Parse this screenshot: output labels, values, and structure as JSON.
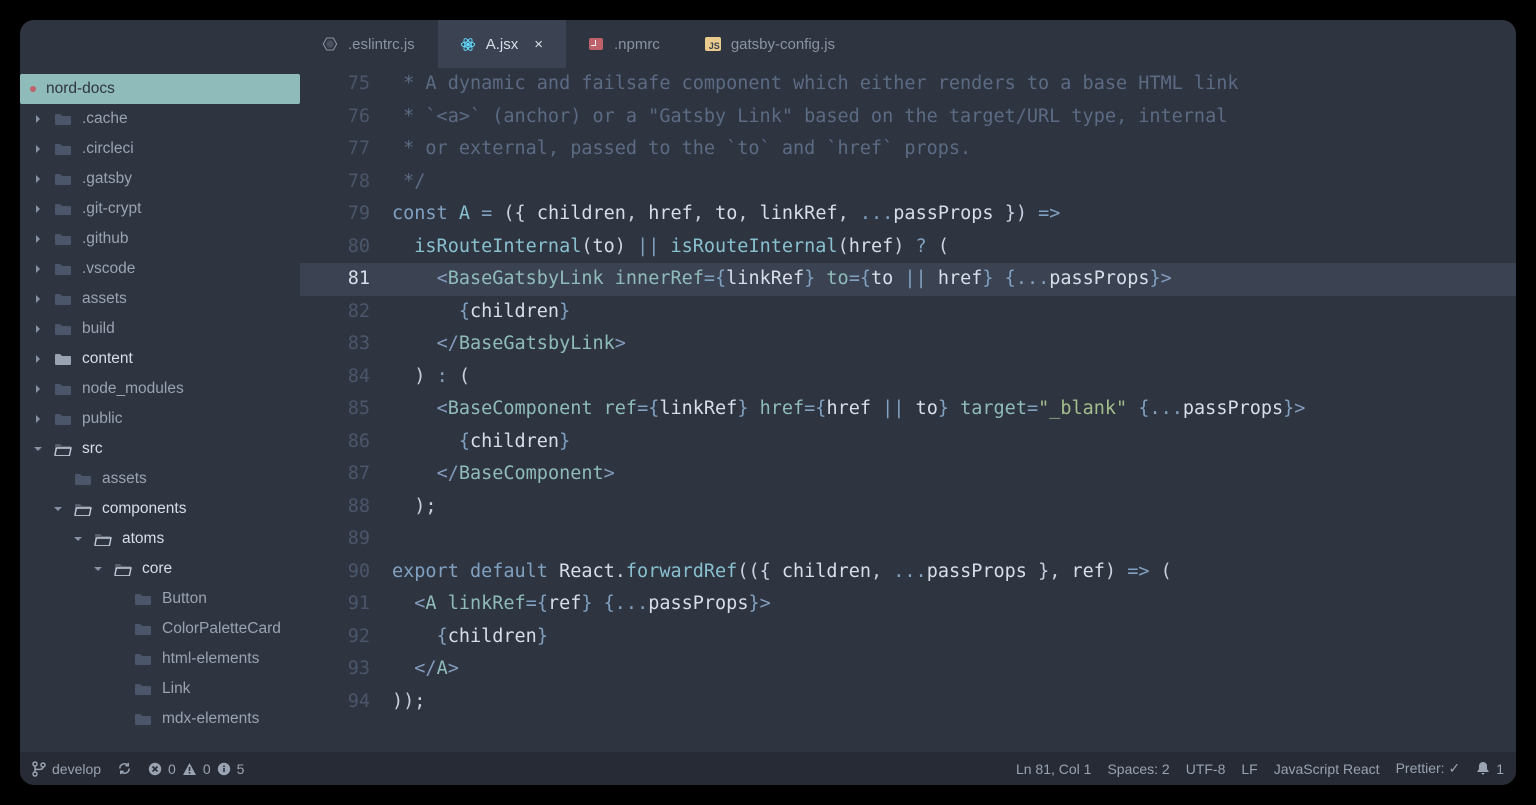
{
  "tabs": [
    {
      "label": ".eslintrc.js",
      "icon": "eslint",
      "active": false
    },
    {
      "label": "A.jsx",
      "icon": "react",
      "active": true
    },
    {
      "label": ".npmrc",
      "icon": "npm",
      "active": false
    },
    {
      "label": "gatsby-config.js",
      "icon": "js",
      "active": false
    }
  ],
  "sidebar": {
    "root": "nord-docs",
    "items": [
      {
        "label": ".cache",
        "type": "folder-closed",
        "depth": 1,
        "muted": true
      },
      {
        "label": ".circleci",
        "type": "folder-closed",
        "depth": 1,
        "muted": true
      },
      {
        "label": ".gatsby",
        "type": "folder-closed",
        "depth": 1,
        "muted": true
      },
      {
        "label": ".git-crypt",
        "type": "folder-closed",
        "depth": 1,
        "muted": true
      },
      {
        "label": ".github",
        "type": "folder-closed",
        "depth": 1,
        "muted": true
      },
      {
        "label": ".vscode",
        "type": "folder-closed",
        "depth": 1,
        "muted": true
      },
      {
        "label": "assets",
        "type": "folder-closed",
        "depth": 1,
        "muted": true
      },
      {
        "label": "build",
        "type": "folder-closed",
        "depth": 1,
        "muted": true
      },
      {
        "label": "content",
        "type": "folder-closed",
        "depth": 1,
        "muted": false
      },
      {
        "label": "node_modules",
        "type": "folder-closed",
        "depth": 1,
        "muted": true
      },
      {
        "label": "public",
        "type": "folder-closed",
        "depth": 1,
        "muted": true
      },
      {
        "label": "src",
        "type": "folder-open",
        "depth": 1,
        "muted": false
      },
      {
        "label": "assets",
        "type": "folder-closed",
        "depth": 2,
        "muted": true
      },
      {
        "label": "components",
        "type": "folder-open",
        "depth": 2,
        "muted": false
      },
      {
        "label": "atoms",
        "type": "folder-open",
        "depth": 3,
        "muted": false
      },
      {
        "label": "core",
        "type": "folder-open",
        "depth": 4,
        "muted": false
      },
      {
        "label": "Button",
        "type": "folder-closed",
        "depth": 5,
        "muted": true
      },
      {
        "label": "ColorPaletteCard",
        "type": "folder-closed",
        "depth": 5,
        "muted": true
      },
      {
        "label": "html-elements",
        "type": "folder-closed",
        "depth": 5,
        "muted": true
      },
      {
        "label": "Link",
        "type": "folder-closed",
        "depth": 5,
        "muted": true
      },
      {
        "label": "mdx-elements",
        "type": "folder-closed",
        "depth": 5,
        "muted": true
      }
    ]
  },
  "code": {
    "first_line_number": 75,
    "current_line": 81,
    "html_lines": [
      " <span class='c-comment'>* A dynamic and failsafe component which either renders to a base HTML link</span>",
      " <span class='c-comment'>* `&lt;a&gt;` (anchor) or a \"Gatsby Link\" based on the target/URL type, internal</span>",
      " <span class='c-comment'>* or external, passed to the `to` and `href` props.</span>",
      " <span class='c-comment'>*/</span>",
      "<span class='c-kw'>const</span> <span class='c-fn'>A</span> <span class='c-kw'>=</span> <span class='c-pun'>({</span> <span class='c-id'>children</span><span class='c-pun'>,</span> <span class='c-id'>href</span><span class='c-pun'>,</span> <span class='c-id'>to</span><span class='c-pun'>,</span> <span class='c-id'>linkRef</span><span class='c-pun'>,</span> <span class='c-kw'>...</span><span class='c-id'>passProps</span> <span class='c-pun'>})</span> <span class='c-kw'>=&gt;</span>",
      "  <span class='c-fn'>isRouteInternal</span><span class='c-pun'>(</span><span class='c-id'>to</span><span class='c-pun'>)</span> <span class='c-kw'>||</span> <span class='c-fn'>isRouteInternal</span><span class='c-pun'>(</span><span class='c-id'>href</span><span class='c-pun'>)</span> <span class='c-kw'>?</span> <span class='c-pun'>(</span>",
      "    <span class='c-tagpun'>&lt;</span><span class='c-tag'>BaseGatsbyLink</span> <span class='c-attr'>innerRef</span><span class='c-kw'>=</span><span class='c-brace'>{</span><span class='c-id'>linkRef</span><span class='c-brace'>}</span> <span class='c-attr'>to</span><span class='c-kw'>=</span><span class='c-brace'>{</span><span class='c-id'>to</span> <span class='c-kw'>||</span> <span class='c-id'>href</span><span class='c-brace'>}</span> <span class='c-brace'>{</span><span class='c-kw'>...</span><span class='c-id'>passProps</span><span class='c-brace'>}</span><span class='c-tagpun'>&gt;</span>",
      "      <span class='c-brace'>{</span><span class='c-id'>children</span><span class='c-brace'>}</span>",
      "    <span class='c-tagpun'>&lt;/</span><span class='c-tag'>BaseGatsbyLink</span><span class='c-tagpun'>&gt;</span>",
      "  <span class='c-pun'>)</span> <span class='c-kw'>:</span> <span class='c-pun'>(</span>",
      "    <span class='c-tagpun'>&lt;</span><span class='c-tag'>BaseComponent</span> <span class='c-attr'>ref</span><span class='c-kw'>=</span><span class='c-brace'>{</span><span class='c-id'>linkRef</span><span class='c-brace'>}</span> <span class='c-attr'>href</span><span class='c-kw'>=</span><span class='c-brace'>{</span><span class='c-id'>href</span> <span class='c-kw'>||</span> <span class='c-id'>to</span><span class='c-brace'>}</span> <span class='c-attr'>target</span><span class='c-kw'>=</span><span class='c-str'>\"_blank\"</span> <span class='c-brace'>{</span><span class='c-kw'>...</span><span class='c-id'>passProps</span><span class='c-brace'>}</span><span class='c-tagpun'>&gt;</span>",
      "      <span class='c-brace'>{</span><span class='c-id'>children</span><span class='c-brace'>}</span>",
      "    <span class='c-tagpun'>&lt;/</span><span class='c-tag'>BaseComponent</span><span class='c-tagpun'>&gt;</span>",
      "  <span class='c-pun'>);</span>",
      "",
      "<span class='c-kw'>export</span> <span class='c-kw'>default</span> <span class='c-id'>React</span><span class='c-pun'>.</span><span class='c-fn'>forwardRef</span><span class='c-pun'>(({</span> <span class='c-id'>children</span><span class='c-pun'>,</span> <span class='c-kw'>...</span><span class='c-id'>passProps</span> <span class='c-pun'>},</span> <span class='c-id'>ref</span><span class='c-pun'>)</span> <span class='c-kw'>=&gt;</span> <span class='c-pun'>(</span>",
      "  <span class='c-tagpun'>&lt;</span><span class='c-tag'>A</span> <span class='c-attr'>linkRef</span><span class='c-kw'>=</span><span class='c-brace'>{</span><span class='c-id'>ref</span><span class='c-brace'>}</span> <span class='c-brace'>{</span><span class='c-kw'>...</span><span class='c-id'>passProps</span><span class='c-brace'>}</span><span class='c-tagpun'>&gt;</span>",
      "    <span class='c-brace'>{</span><span class='c-id'>children</span><span class='c-brace'>}</span>",
      "  <span class='c-tagpun'>&lt;/</span><span class='c-tag'>A</span><span class='c-tagpun'>&gt;</span>",
      "<span class='c-pun'>));</span>"
    ]
  },
  "status": {
    "branch": "develop",
    "errors": "0",
    "warnings": "0",
    "info": "5",
    "position": "Ln 81, Col 1",
    "spaces": "Spaces: 2",
    "encoding": "UTF-8",
    "eol": "LF",
    "lang": "JavaScript React",
    "prettier": "Prettier: ✓",
    "notifications": "1"
  }
}
